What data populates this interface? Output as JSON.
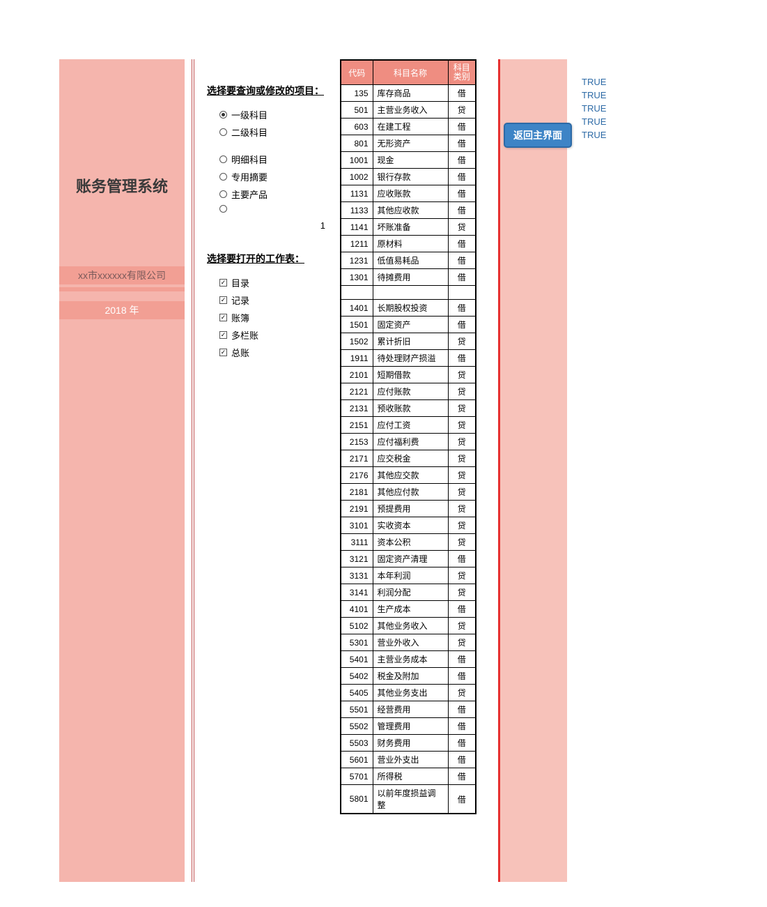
{
  "left": {
    "title": "账务管理系统",
    "company": "xx市xxxxxx有限公司",
    "year": "2018 年"
  },
  "mid": {
    "heading1": "选择要查询或修改的项目：",
    "heading2": "选择要打开的工作表：",
    "radios": [
      "一级科目",
      "二级科目",
      "明细科目",
      "专用摘要",
      "主要产品",
      ""
    ],
    "radio_selected": 0,
    "radio_gap_after": 1,
    "number": "1",
    "checks": [
      "目录",
      "记录",
      "账簿",
      "多栏账",
      "总账"
    ]
  },
  "table": {
    "headers": {
      "code": "代码",
      "name": "科目名称",
      "type": "科目类别"
    },
    "rows": [
      {
        "code": "135",
        "name": "库存商品",
        "type": "借"
      },
      {
        "code": "501",
        "name": "主营业务收入",
        "type": "贷"
      },
      {
        "code": "603",
        "name": "在建工程",
        "type": "借"
      },
      {
        "code": "801",
        "name": "无形资产",
        "type": "借"
      },
      {
        "code": "1001",
        "name": "现金",
        "type": "借"
      },
      {
        "code": "1002",
        "name": "银行存款",
        "type": "借"
      },
      {
        "code": "1131",
        "name": "应收账款",
        "type": "借"
      },
      {
        "code": "1133",
        "name": "其他应收款",
        "type": "借"
      },
      {
        "code": "1141",
        "name": "坏账准备",
        "type": "贷"
      },
      {
        "code": "1211",
        "name": "原材料",
        "type": "借"
      },
      {
        "code": "1231",
        "name": "低值易耗品",
        "type": "借"
      },
      {
        "code": "1301",
        "name": "待摊费用",
        "type": "借"
      },
      {
        "code": "",
        "name": "",
        "type": ""
      },
      {
        "code": "1401",
        "name": "长期股权投资",
        "type": "借"
      },
      {
        "code": "1501",
        "name": "固定资产",
        "type": "借"
      },
      {
        "code": "1502",
        "name": "累计折旧",
        "type": "贷"
      },
      {
        "code": "1911",
        "name": "待处理财产损溢",
        "type": "借"
      },
      {
        "code": "2101",
        "name": "短期借款",
        "type": "贷"
      },
      {
        "code": "2121",
        "name": "应付账款",
        "type": "贷"
      },
      {
        "code": "2131",
        "name": "预收账款",
        "type": "贷"
      },
      {
        "code": "2151",
        "name": "应付工资",
        "type": "贷"
      },
      {
        "code": "2153",
        "name": "应付福利费",
        "type": "贷"
      },
      {
        "code": "2171",
        "name": "应交税金",
        "type": "贷"
      },
      {
        "code": "2176",
        "name": "其他应交款",
        "type": "贷"
      },
      {
        "code": "2181",
        "name": "其他应付款",
        "type": "贷"
      },
      {
        "code": "2191",
        "name": "预提费用",
        "type": "贷"
      },
      {
        "code": "3101",
        "name": "实收资本",
        "type": "贷"
      },
      {
        "code": "3111",
        "name": "资本公积",
        "type": "贷"
      },
      {
        "code": "3121",
        "name": "固定资产清理",
        "type": "借"
      },
      {
        "code": "3131",
        "name": "本年利润",
        "type": "贷"
      },
      {
        "code": "3141",
        "name": "利润分配",
        "type": "贷"
      },
      {
        "code": "4101",
        "name": "生产成本",
        "type": "借"
      },
      {
        "code": "5102",
        "name": "其他业务收入",
        "type": "贷"
      },
      {
        "code": "5301",
        "name": "营业外收入",
        "type": "贷"
      },
      {
        "code": "5401",
        "name": "主营业务成本",
        "type": "借"
      },
      {
        "code": "5402",
        "name": "税金及附加",
        "type": "借"
      },
      {
        "code": "5405",
        "name": "其他业务支出",
        "type": "贷"
      },
      {
        "code": "5501",
        "name": "经营费用",
        "type": "借"
      },
      {
        "code": "5502",
        "name": "管理费用",
        "type": "借"
      },
      {
        "code": "5503",
        "name": "财务费用",
        "type": "借"
      },
      {
        "code": "5601",
        "name": "营业外支出",
        "type": "借"
      },
      {
        "code": "5701",
        "name": "所得税",
        "type": "借"
      },
      {
        "code": "5801",
        "name": "以前年度损益调整",
        "type": "借"
      }
    ]
  },
  "button": {
    "label": "返回主界面"
  },
  "true_values": [
    "TRUE",
    "TRUE",
    "TRUE",
    "TRUE",
    "TRUE"
  ]
}
